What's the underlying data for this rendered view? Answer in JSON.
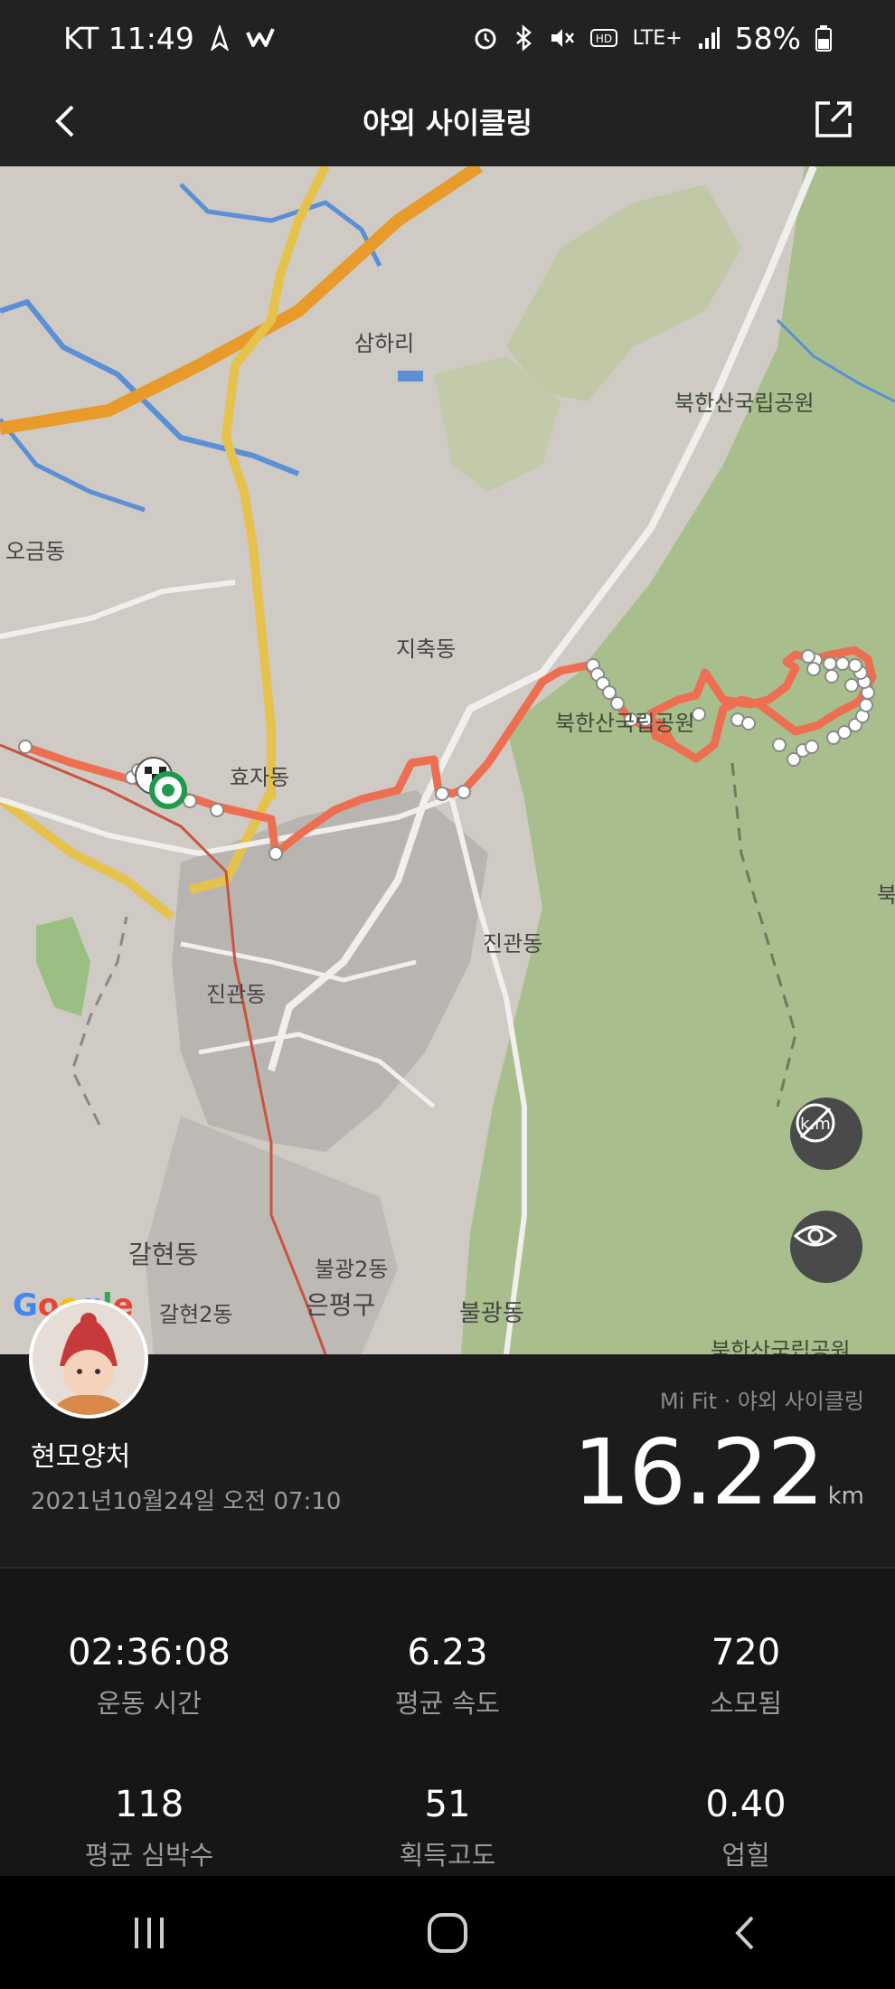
{
  "status_bar": {
    "carrier_time": "KT 11:49",
    "network": "LTE+",
    "battery": "58%",
    "icons": [
      "navigation-icon",
      "w-app-icon",
      "alarm-icon",
      "bluetooth-icon",
      "mute-icon",
      "hd-icon",
      "signal-icon",
      "battery-icon"
    ]
  },
  "app_bar": {
    "title": "야외 사이클링",
    "back_icon": "chevron-left-icon",
    "share_icon": "share-icon"
  },
  "map": {
    "labels": {
      "samhari": "삼하리",
      "bukhansan1": "북한산국립공원",
      "ogeumdong": "오금동",
      "jichukdong": "지축동",
      "bukhansan_mid": "북한산국립공원",
      "hyojadong": "효자동",
      "jingwandong_e": "진관동",
      "jingwandong_w": "진관동",
      "galhyeondong": "갈현동",
      "bulgwang2dong": "불광2동",
      "eunpyeonggu": "은평구",
      "bulgwangdong": "불광동",
      "galhyeon2dong": "갈현2동",
      "bukhansan_bottom": "북한산국립공원",
      "edge_char": "북"
    },
    "google_logo": "Google",
    "buttons": [
      "hide-km-markers-icon",
      "eye-icon"
    ],
    "colors": {
      "route": "#ee6e52",
      "park": "#a8bf8d",
      "land": "#cfcac3",
      "highway": "#e89a2a",
      "road": "#e5c24c",
      "water": "#5b8fd6"
    }
  },
  "workout": {
    "source": "Mi Fit · 야외 사이클링",
    "user_name": "현모양처",
    "datetime": "2021년10월24일 오전 07:10",
    "distance": "16.22",
    "distance_unit": "km"
  },
  "stats": [
    {
      "value": "02:36:08",
      "label": "운동 시간"
    },
    {
      "value": "6.23",
      "label": "평균 속도"
    },
    {
      "value": "720",
      "label": "소모됨"
    },
    {
      "value": "118",
      "label": "평균 심박수"
    },
    {
      "value": "51",
      "label": "획득고도"
    },
    {
      "value": "0.40",
      "label": "업힐"
    }
  ],
  "nav_bar": {
    "icons": [
      "recent-apps-icon",
      "home-icon",
      "back-icon"
    ]
  }
}
